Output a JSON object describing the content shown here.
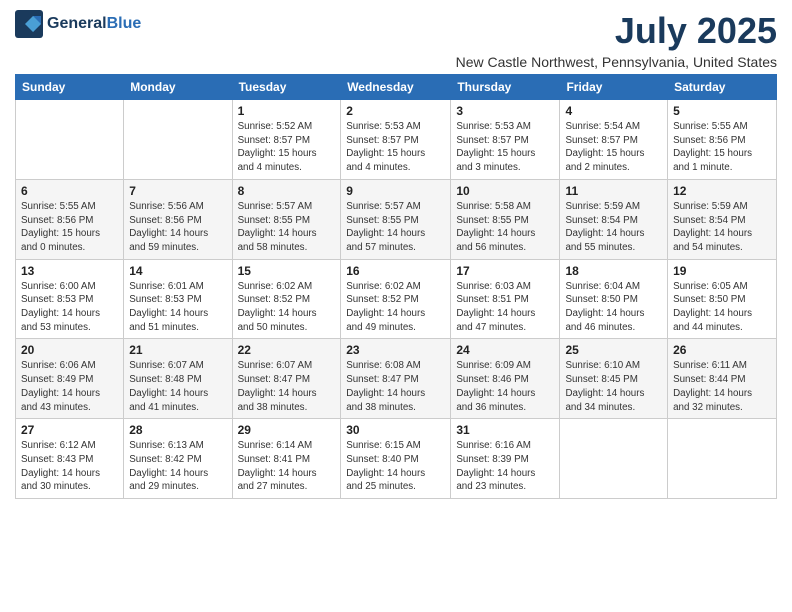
{
  "header": {
    "logo_line1": "General",
    "logo_line2": "Blue",
    "month_title": "July 2025",
    "subtitle": "New Castle Northwest, Pennsylvania, United States"
  },
  "weekdays": [
    "Sunday",
    "Monday",
    "Tuesday",
    "Wednesday",
    "Thursday",
    "Friday",
    "Saturday"
  ],
  "weeks": [
    [
      {
        "day": "",
        "info": ""
      },
      {
        "day": "",
        "info": ""
      },
      {
        "day": "1",
        "info": "Sunrise: 5:52 AM\nSunset: 8:57 PM\nDaylight: 15 hours\nand 4 minutes."
      },
      {
        "day": "2",
        "info": "Sunrise: 5:53 AM\nSunset: 8:57 PM\nDaylight: 15 hours\nand 4 minutes."
      },
      {
        "day": "3",
        "info": "Sunrise: 5:53 AM\nSunset: 8:57 PM\nDaylight: 15 hours\nand 3 minutes."
      },
      {
        "day": "4",
        "info": "Sunrise: 5:54 AM\nSunset: 8:57 PM\nDaylight: 15 hours\nand 2 minutes."
      },
      {
        "day": "5",
        "info": "Sunrise: 5:55 AM\nSunset: 8:56 PM\nDaylight: 15 hours\nand 1 minute."
      }
    ],
    [
      {
        "day": "6",
        "info": "Sunrise: 5:55 AM\nSunset: 8:56 PM\nDaylight: 15 hours\nand 0 minutes."
      },
      {
        "day": "7",
        "info": "Sunrise: 5:56 AM\nSunset: 8:56 PM\nDaylight: 14 hours\nand 59 minutes."
      },
      {
        "day": "8",
        "info": "Sunrise: 5:57 AM\nSunset: 8:55 PM\nDaylight: 14 hours\nand 58 minutes."
      },
      {
        "day": "9",
        "info": "Sunrise: 5:57 AM\nSunset: 8:55 PM\nDaylight: 14 hours\nand 57 minutes."
      },
      {
        "day": "10",
        "info": "Sunrise: 5:58 AM\nSunset: 8:55 PM\nDaylight: 14 hours\nand 56 minutes."
      },
      {
        "day": "11",
        "info": "Sunrise: 5:59 AM\nSunset: 8:54 PM\nDaylight: 14 hours\nand 55 minutes."
      },
      {
        "day": "12",
        "info": "Sunrise: 5:59 AM\nSunset: 8:54 PM\nDaylight: 14 hours\nand 54 minutes."
      }
    ],
    [
      {
        "day": "13",
        "info": "Sunrise: 6:00 AM\nSunset: 8:53 PM\nDaylight: 14 hours\nand 53 minutes."
      },
      {
        "day": "14",
        "info": "Sunrise: 6:01 AM\nSunset: 8:53 PM\nDaylight: 14 hours\nand 51 minutes."
      },
      {
        "day": "15",
        "info": "Sunrise: 6:02 AM\nSunset: 8:52 PM\nDaylight: 14 hours\nand 50 minutes."
      },
      {
        "day": "16",
        "info": "Sunrise: 6:02 AM\nSunset: 8:52 PM\nDaylight: 14 hours\nand 49 minutes."
      },
      {
        "day": "17",
        "info": "Sunrise: 6:03 AM\nSunset: 8:51 PM\nDaylight: 14 hours\nand 47 minutes."
      },
      {
        "day": "18",
        "info": "Sunrise: 6:04 AM\nSunset: 8:50 PM\nDaylight: 14 hours\nand 46 minutes."
      },
      {
        "day": "19",
        "info": "Sunrise: 6:05 AM\nSunset: 8:50 PM\nDaylight: 14 hours\nand 44 minutes."
      }
    ],
    [
      {
        "day": "20",
        "info": "Sunrise: 6:06 AM\nSunset: 8:49 PM\nDaylight: 14 hours\nand 43 minutes."
      },
      {
        "day": "21",
        "info": "Sunrise: 6:07 AM\nSunset: 8:48 PM\nDaylight: 14 hours\nand 41 minutes."
      },
      {
        "day": "22",
        "info": "Sunrise: 6:07 AM\nSunset: 8:47 PM\nDaylight: 14 hours\nand 38 minutes."
      },
      {
        "day": "23",
        "info": "Sunrise: 6:08 AM\nSunset: 8:47 PM\nDaylight: 14 hours\nand 38 minutes."
      },
      {
        "day": "24",
        "info": "Sunrise: 6:09 AM\nSunset: 8:46 PM\nDaylight: 14 hours\nand 36 minutes."
      },
      {
        "day": "25",
        "info": "Sunrise: 6:10 AM\nSunset: 8:45 PM\nDaylight: 14 hours\nand 34 minutes."
      },
      {
        "day": "26",
        "info": "Sunrise: 6:11 AM\nSunset: 8:44 PM\nDaylight: 14 hours\nand 32 minutes."
      }
    ],
    [
      {
        "day": "27",
        "info": "Sunrise: 6:12 AM\nSunset: 8:43 PM\nDaylight: 14 hours\nand 30 minutes."
      },
      {
        "day": "28",
        "info": "Sunrise: 6:13 AM\nSunset: 8:42 PM\nDaylight: 14 hours\nand 29 minutes."
      },
      {
        "day": "29",
        "info": "Sunrise: 6:14 AM\nSunset: 8:41 PM\nDaylight: 14 hours\nand 27 minutes."
      },
      {
        "day": "30",
        "info": "Sunrise: 6:15 AM\nSunset: 8:40 PM\nDaylight: 14 hours\nand 25 minutes."
      },
      {
        "day": "31",
        "info": "Sunrise: 6:16 AM\nSunset: 8:39 PM\nDaylight: 14 hours\nand 23 minutes."
      },
      {
        "day": "",
        "info": ""
      },
      {
        "day": "",
        "info": ""
      }
    ]
  ]
}
